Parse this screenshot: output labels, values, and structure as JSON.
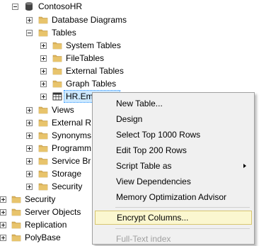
{
  "tree": {
    "database": "ContosoHR",
    "database_diagrams": "Database Diagrams",
    "tables": "Tables",
    "system_tables": "System Tables",
    "file_tables": "FileTables",
    "external_tables": "External Tables",
    "graph_tables": "Graph Tables",
    "selected_table": "HR.Emp",
    "views": "Views",
    "external_resources": "External R",
    "synonyms": "Synonyms",
    "programmability": "Programm",
    "service_broker": "Service Br",
    "storage": "Storage",
    "security": "Security",
    "root_security": "Security",
    "root_server_objects": "Server Objects",
    "root_replication": "Replication",
    "root_polybase": "PolyBase"
  },
  "context_menu": {
    "items": [
      "New Table...",
      "Design",
      "Select Top 1000 Rows",
      "Edit Top 200 Rows",
      "Script Table as",
      "View Dependencies",
      "Memory Optimization Advisor",
      "Encrypt Columns...",
      "Full-Text index"
    ]
  },
  "colors": {
    "folder": "#dcb35c",
    "selection_bg": "#cce8ff",
    "hover_bg": "#fbf7d0",
    "menu_bg": "#f0f0f0"
  },
  "icons": {
    "database": "database-cylinder-icon",
    "folder": "folder-icon",
    "table": "table-grid-icon",
    "expand": "plus-expander-icon",
    "collapse": "minus-expander-icon"
  }
}
